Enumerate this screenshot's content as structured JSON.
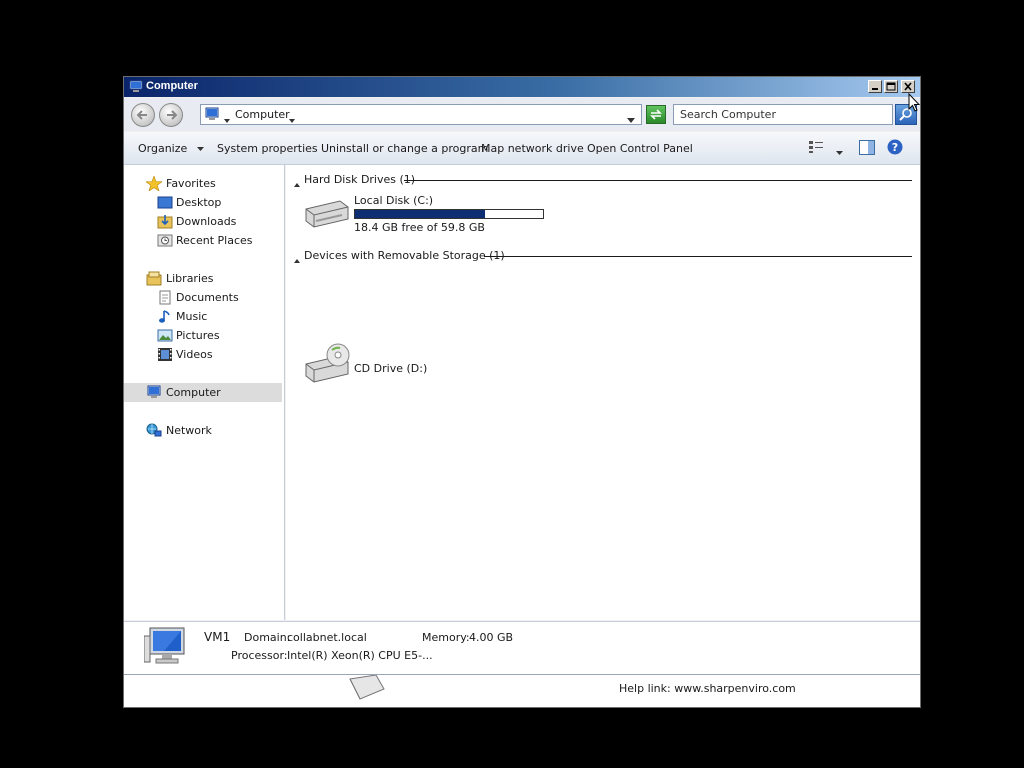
{
  "window": {
    "title": "Computer",
    "buttons": [
      "minimize",
      "maximize",
      "close"
    ]
  },
  "navbar": {
    "address": "Computer",
    "search_placeholder": "Search Computer"
  },
  "commandbar": {
    "organize": "Organize",
    "items": [
      "System properties",
      "Uninstall or change a program",
      "Map network drive",
      "Open Control Panel"
    ]
  },
  "sidebar": {
    "favorites": {
      "label": "Favorites",
      "items": [
        "Desktop",
        "Downloads",
        "Recent Places"
      ]
    },
    "libraries": {
      "label": "Libraries",
      "items": [
        "Documents",
        "Music",
        "Pictures",
        "Videos"
      ]
    },
    "computer": "Computer",
    "network": "Network"
  },
  "content": {
    "groups": [
      {
        "title": "Hard Disk Drives (1)"
      },
      {
        "title": "Devices with Removable Storage (1)"
      }
    ],
    "drives": [
      {
        "name": "Local Disk (C:)",
        "free_text": "18.4 GB free of 59.8 GB",
        "used_fraction": 0.69
      },
      {
        "name": "CD Drive (D:)"
      }
    ]
  },
  "details": {
    "name": "VM1",
    "domain_label": "Domain:",
    "domain_value": "collabnet.local",
    "memory_label": "Memory:",
    "memory_value": "4.00 GB",
    "processor_label": "Processor:",
    "processor_value": "Intel(R) Xeon(R) CPU E5-..."
  },
  "statusbar": {
    "help_text": "Help link: www.sharpenviro.com"
  },
  "colors": {
    "title_gradient_start": "#0a246a",
    "usage_bar": "#0d2e73",
    "selection": "#dcdcdc"
  }
}
